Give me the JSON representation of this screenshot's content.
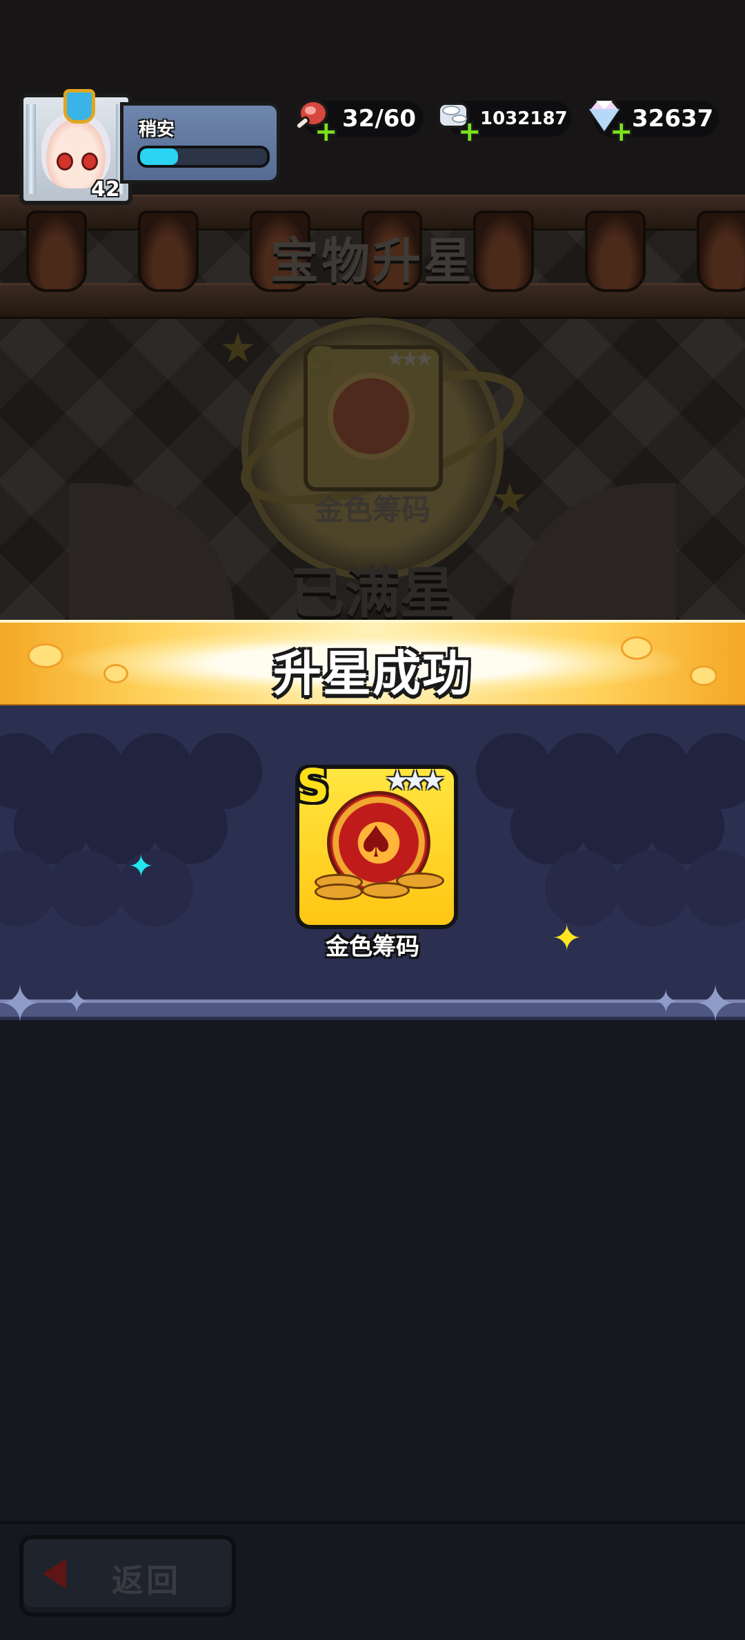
{
  "header": {
    "player_name": "稍安",
    "player_level": "42",
    "xp_progress": 0.3,
    "resources": [
      {
        "name": "stamina",
        "icon": "meat-drumstick-icon",
        "value": "32/60"
      },
      {
        "name": "gold",
        "icon": "silver-coins-icon",
        "value": "1032187"
      },
      {
        "name": "gems",
        "icon": "diamond-icon",
        "value": "32637"
      }
    ]
  },
  "background_screen": {
    "title": "宝物升星",
    "item_name": "金色筹码",
    "status": "已满星"
  },
  "result": {
    "banner_text": "升星成功",
    "item_grade": "S",
    "item_stars": 3,
    "item_name": "金色筹码"
  },
  "footer": {
    "back_label": "返回"
  },
  "colors": {
    "banner_gold": "#ffd15a",
    "card_yellow": "#ffc614",
    "xp_cyan": "#2ad4f2",
    "plus_green": "#7be31c",
    "panel_navy": "#2b2f50"
  }
}
